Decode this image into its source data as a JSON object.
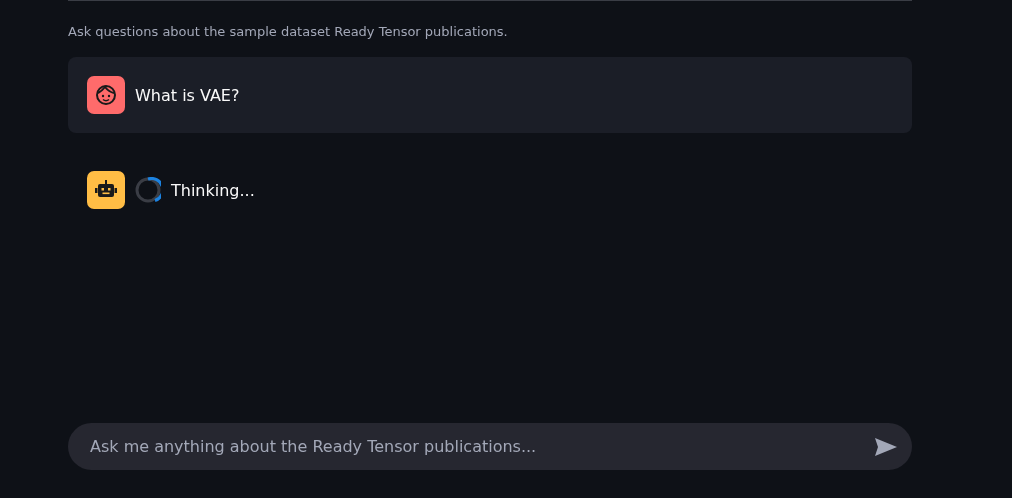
{
  "caption": "Ask questions about the sample dataset Ready Tensor publications.",
  "messages": [
    {
      "kind": "user",
      "text": "What is VAE?",
      "loading": false
    },
    {
      "kind": "assistant",
      "text": "Thinking...",
      "loading": true
    }
  ],
  "chat_input": {
    "placeholder": "Ask me anything about the Ready Tensor publications..."
  }
}
